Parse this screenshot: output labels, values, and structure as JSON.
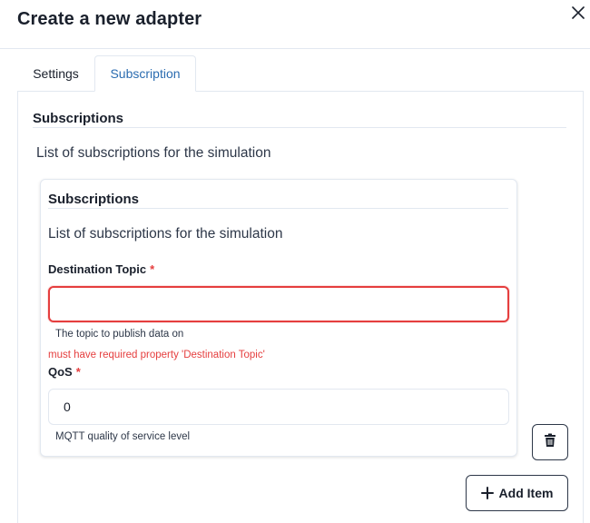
{
  "modal": {
    "title": "Create a new adapter",
    "close_icon": "close-icon"
  },
  "tabs": [
    {
      "label": "Settings",
      "active": false
    },
    {
      "label": "Subscription",
      "active": true
    }
  ],
  "section": {
    "title": "Subscriptions",
    "description": "List of subscriptions for the simulation"
  },
  "item": {
    "title": "Subscriptions",
    "description": "List of subscriptions for the simulation",
    "destination_topic": {
      "label": "Destination Topic",
      "required_mark": "*",
      "value": "",
      "helper": "The topic to publish data on",
      "error": "must have required property 'Destination Topic'"
    },
    "qos": {
      "label": "QoS",
      "required_mark": "*",
      "value": "0",
      "helper": "MQTT quality of service level"
    },
    "delete_icon": "trash-icon"
  },
  "actions": {
    "add_item_label": "Add Item",
    "add_icon": "plus-icon"
  },
  "colors": {
    "accent": "#2b6cb0",
    "error": "#e53e3e",
    "border": "#e2e8f0",
    "text": "#1a202c"
  }
}
